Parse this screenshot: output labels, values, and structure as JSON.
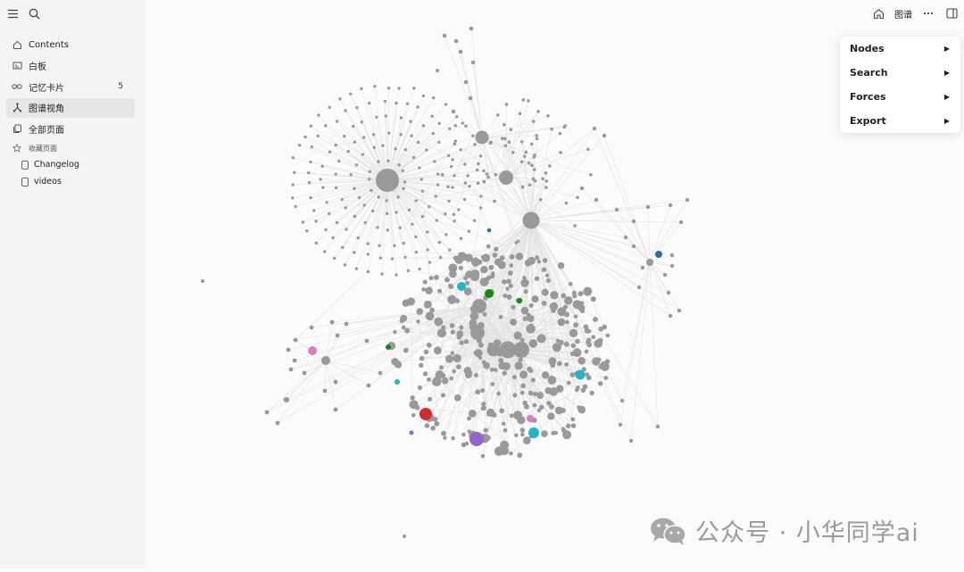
{
  "sidebar": {
    "nav": [
      {
        "label": "Contents",
        "icon": "home-icon"
      },
      {
        "label": "白板",
        "icon": "whiteboard-icon"
      },
      {
        "label": "记忆卡片",
        "icon": "infinity-icon",
        "badge": "5"
      },
      {
        "label": "图谱视角",
        "icon": "graph-icon",
        "active": true
      },
      {
        "label": "全部页面",
        "icon": "pages-icon"
      }
    ],
    "favorites_label": "收藏页面",
    "favorites": [
      "Changelog",
      "videos"
    ]
  },
  "header": {
    "title": "图谱"
  },
  "menu": {
    "items": [
      "Nodes",
      "Search",
      "Forces",
      "Export"
    ]
  },
  "watermark": "公众号 · 小华同学ai",
  "colors": {
    "node": "#999999",
    "edge": "#e2e2e2",
    "cyan": "#1ab8c8",
    "green": "#138a12",
    "blue": "#2a6fa8",
    "pink": "#e178c0",
    "red": "#d52b2b",
    "purple": "#9464c8"
  }
}
